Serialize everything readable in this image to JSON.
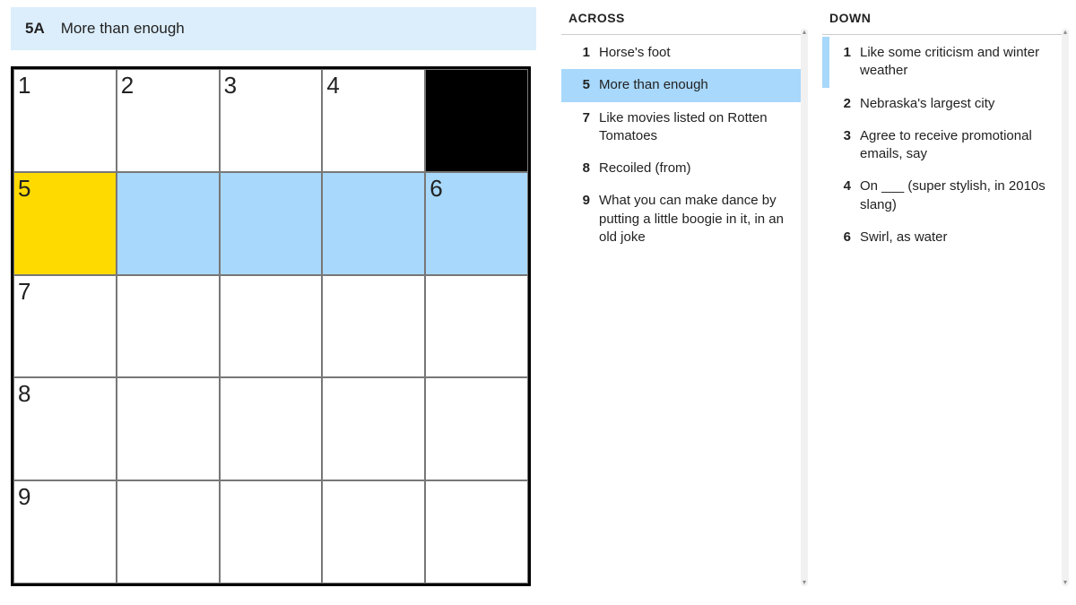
{
  "current_clue": {
    "id": "5A",
    "text": "More than enough"
  },
  "grid": {
    "size": 5,
    "cells": [
      {
        "r": 0,
        "c": 0,
        "num": "1"
      },
      {
        "r": 0,
        "c": 1,
        "num": "2"
      },
      {
        "r": 0,
        "c": 2,
        "num": "3"
      },
      {
        "r": 0,
        "c": 3,
        "num": "4"
      },
      {
        "r": 0,
        "c": 4,
        "black": true
      },
      {
        "r": 1,
        "c": 0,
        "num": "5",
        "cursor": true
      },
      {
        "r": 1,
        "c": 1,
        "hl": true
      },
      {
        "r": 1,
        "c": 2,
        "hl": true
      },
      {
        "r": 1,
        "c": 3,
        "hl": true
      },
      {
        "r": 1,
        "c": 4,
        "num": "6",
        "hl": true
      },
      {
        "r": 2,
        "c": 0,
        "num": "7"
      },
      {
        "r": 2,
        "c": 1
      },
      {
        "r": 2,
        "c": 2
      },
      {
        "r": 2,
        "c": 3
      },
      {
        "r": 2,
        "c": 4
      },
      {
        "r": 3,
        "c": 0,
        "num": "8"
      },
      {
        "r": 3,
        "c": 1
      },
      {
        "r": 3,
        "c": 2
      },
      {
        "r": 3,
        "c": 3
      },
      {
        "r": 3,
        "c": 4
      },
      {
        "r": 4,
        "c": 0,
        "num": "9"
      },
      {
        "r": 4,
        "c": 1
      },
      {
        "r": 4,
        "c": 2
      },
      {
        "r": 4,
        "c": 3
      },
      {
        "r": 4,
        "c": 4
      }
    ]
  },
  "across": {
    "heading": "ACROSS",
    "clues": [
      {
        "num": "1",
        "text": "Horse's foot"
      },
      {
        "num": "5",
        "text": "More than enough",
        "active": true
      },
      {
        "num": "7",
        "text": "Like movies listed on Rotten Tomatoes"
      },
      {
        "num": "8",
        "text": "Recoiled (from)"
      },
      {
        "num": "9",
        "text": "What you can make dance by putting a little boogie in it, in an old joke"
      }
    ]
  },
  "down": {
    "heading": "DOWN",
    "clues": [
      {
        "num": "1",
        "text": "Like some criticism and winter weather",
        "related": true
      },
      {
        "num": "2",
        "text": "Nebraska's largest city"
      },
      {
        "num": "3",
        "text": "Agree to receive promotional emails, say"
      },
      {
        "num": "4",
        "text": "On ___ (super stylish, in 2010s slang)"
      },
      {
        "num": "6",
        "text": "Swirl, as water"
      }
    ]
  }
}
